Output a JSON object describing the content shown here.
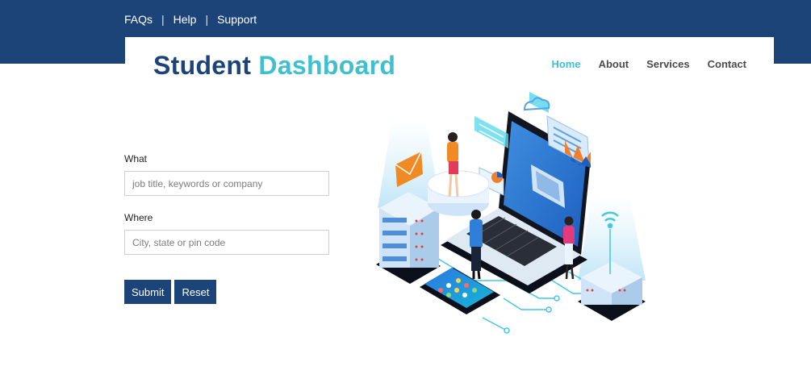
{
  "topbar": {
    "links": [
      "FAQs",
      "Help",
      "Support"
    ],
    "separator": "|"
  },
  "brand": {
    "part1": "Student",
    "part2": "Dashboard"
  },
  "nav": {
    "items": [
      "Home",
      "About",
      "Services",
      "Contact"
    ],
    "active": "Home"
  },
  "form": {
    "what_label": "What",
    "what_placeholder": "job title, keywords or company",
    "where_label": "Where",
    "where_placeholder": "City, state or pin code",
    "submit_label": "Submit",
    "reset_label": "Reset"
  },
  "colors": {
    "primary": "#1c4479",
    "accent": "#3fc0cf",
    "text": "#4a4a4a"
  },
  "illustration": {
    "name": "isometric-laptop-servers-people-illustration"
  }
}
